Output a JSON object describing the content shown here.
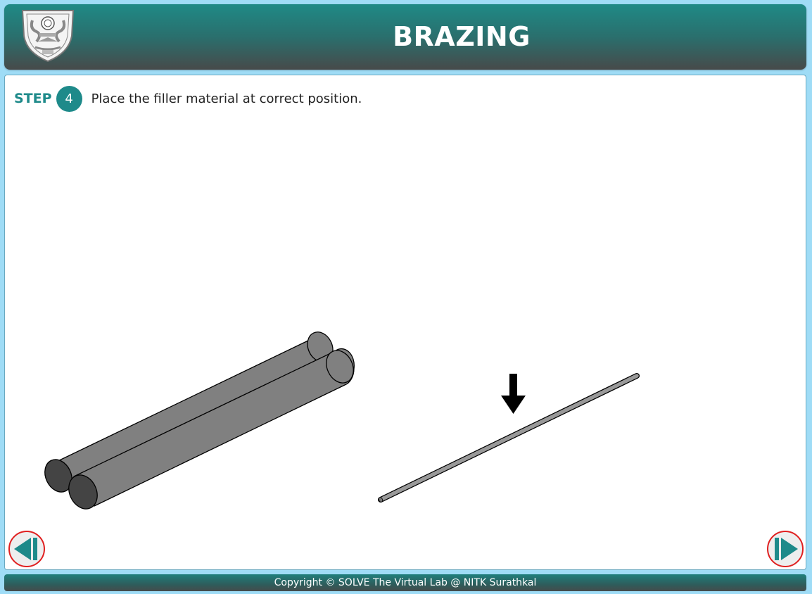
{
  "header": {
    "title": "BRAZING",
    "logo_icon": "nitk-emblem-icon"
  },
  "step": {
    "label": "STEP",
    "number": "4",
    "instruction": "Place the filler material at correct position."
  },
  "scene": {
    "workpieces_icon": "twin-cylinder-rods",
    "filler_icon": "filler-rod",
    "pointer_icon": "arrow-down-icon",
    "rod_color": "#808080",
    "rod_end_color": "#444444",
    "filler_color": "#999999"
  },
  "navigation": {
    "prev_icon": "prev-icon",
    "next_icon": "next-icon",
    "accent_color": "#1e8a8a",
    "ring_color": "#e02020"
  },
  "footer": {
    "copyright": "Copyright © SOLVE The Virtual Lab @ NITK Surathkal"
  }
}
